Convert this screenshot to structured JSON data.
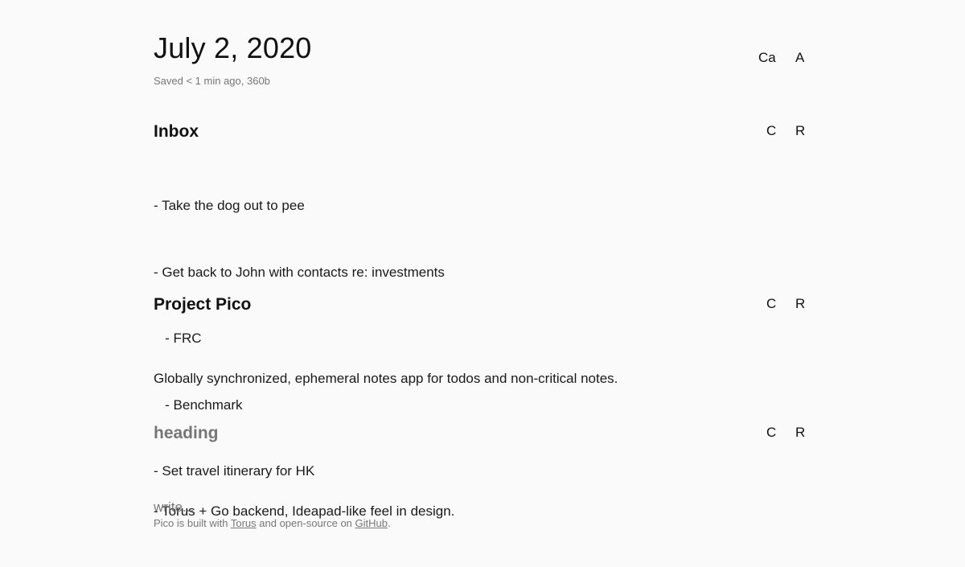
{
  "header": {
    "date": "July 2, 2020",
    "saved_status": "Saved < 1 min ago, 360b",
    "collapse_all_label": "Ca",
    "add_label": "A"
  },
  "blocks": [
    {
      "heading": "Inbox",
      "collapse_label": "C",
      "remove_label": "R",
      "lines": [
        "- Take the dog out to pee",
        "- Get back to John with contacts re: investments",
        "   - FRC",
        "   - Benchmark",
        "- Set travel itinerary for HK"
      ]
    },
    {
      "heading": "Project Pico",
      "collapse_label": "C",
      "remove_label": "R",
      "lines": [
        "Globally synchronized, ephemeral notes app for todos and non-critical notes.",
        "",
        "- Torus + Go backend, Ideapad-like feel in design."
      ]
    },
    {
      "heading_placeholder": "heading",
      "collapse_label": "C",
      "remove_label": "R",
      "body_placeholder": "write..."
    }
  ],
  "footer": {
    "prefix": "Pico is built with ",
    "torus_link": "Torus",
    "middle": " and open-source on ",
    "github_link": "GitHub",
    "suffix": "."
  }
}
